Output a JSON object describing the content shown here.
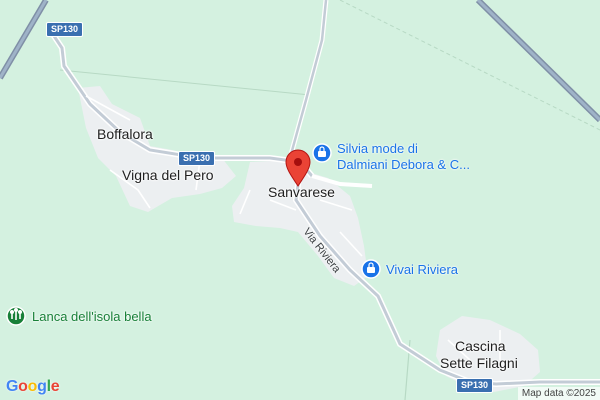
{
  "map": {
    "places": {
      "boffalora": "Boffalora",
      "vigna_del_pero": "Vigna del Pero",
      "sanvarese": "Sanvarese",
      "cascina_line1": "Cascina",
      "cascina_line2": "Sette Filagni"
    },
    "pois": {
      "silvia_line1": "Silvia mode di",
      "silvia_line2": "Dalmiani Debora & C...",
      "vivai": "Vivai Riviera",
      "lanca": "Lanca dell'isola bella"
    },
    "road_shields": [
      "SP130",
      "SP130",
      "SP130"
    ],
    "street_name": "Via Riviera",
    "attribution": "Map data ©2025",
    "logo": "Google",
    "colors": {
      "land": "#d4f1e0",
      "built_area": "#eceff1",
      "road": "#c3ccd6",
      "shield": "#3a6fb0",
      "poi_blue": "#1a73e8",
      "poi_green": "#188038",
      "marker": "#ea4335"
    }
  }
}
